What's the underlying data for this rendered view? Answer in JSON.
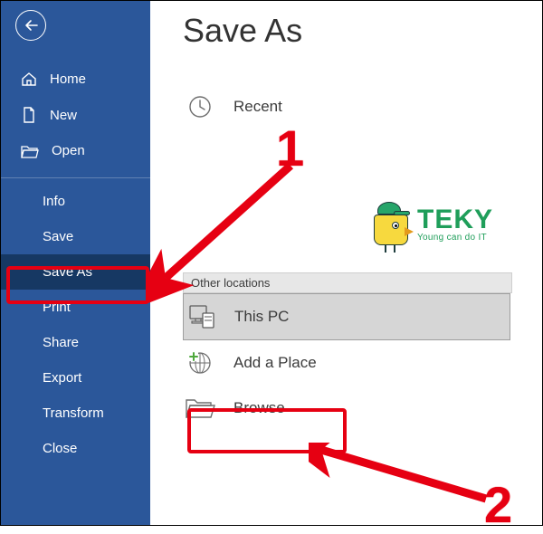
{
  "page_title": "Save As",
  "sidebar": {
    "back_name": "back",
    "items_top": [
      {
        "id": "home",
        "label": "Home",
        "icon": "home-icon"
      },
      {
        "id": "new",
        "label": "New",
        "icon": "new-doc-icon"
      },
      {
        "id": "open",
        "label": "Open",
        "icon": "folder-open-icon"
      }
    ],
    "items_bottom": [
      {
        "id": "info",
        "label": "Info"
      },
      {
        "id": "save",
        "label": "Save"
      },
      {
        "id": "saveas",
        "label": "Save As",
        "selected": true,
        "highlight": true
      },
      {
        "id": "print",
        "label": "Print"
      },
      {
        "id": "share",
        "label": "Share"
      },
      {
        "id": "export",
        "label": "Export"
      },
      {
        "id": "transform",
        "label": "Transform"
      },
      {
        "id": "close",
        "label": "Close"
      }
    ]
  },
  "main": {
    "recent": {
      "label": "Recent",
      "icon": "clock-icon"
    },
    "section_header": "Other locations",
    "locations": [
      {
        "id": "thispc",
        "label": "This PC",
        "icon": "this-pc-icon",
        "selected": true
      },
      {
        "id": "addplace",
        "label": "Add a Place",
        "icon": "add-place-icon"
      },
      {
        "id": "browse",
        "label": "Browse",
        "icon": "folder-open-icon",
        "highlight": true
      }
    ]
  },
  "annotation": {
    "numbers": {
      "one": "1",
      "two": "2"
    },
    "logo": {
      "brand": "TEKY",
      "tag": "Young can do IT"
    },
    "accent_red": "#e60012",
    "accent_green": "#1f9e5a"
  }
}
